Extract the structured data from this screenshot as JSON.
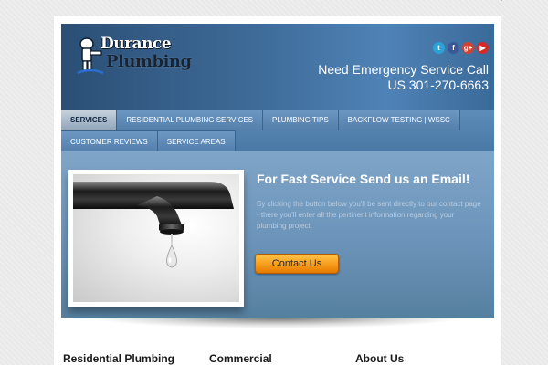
{
  "header": {
    "logo_line1": "Durance",
    "logo_line2": "Plumbing",
    "emergency_line1": "Need Emergency Service Call",
    "emergency_line2": "US 301-270-6663",
    "social": [
      {
        "name": "twitter",
        "glyph": "t"
      },
      {
        "name": "facebook",
        "glyph": "f"
      },
      {
        "name": "google-plus",
        "glyph": "g+"
      },
      {
        "name": "youtube",
        "glyph": "▶"
      }
    ]
  },
  "nav": {
    "row1": [
      "SERVICES",
      "RESIDENTIAL PLUMBING SERVICES",
      "PLUMBING TIPS",
      "BACKFLOW TESTING | WSSC"
    ],
    "row2": [
      "CUSTOMER REVIEWS",
      "SERVICE AREAS"
    ],
    "active": "SERVICES"
  },
  "hero": {
    "title": "For Fast Service Send us an Email!",
    "text": "By clicking the button below you'll be sent directly to our contact page - there you'll enter all the pertinent information regarding your plumbing project.",
    "button_label": "Contact Us"
  },
  "columns": {
    "col1_title": "Residential Plumbing",
    "col2_title": "Commercial",
    "col3_title": "About Us"
  },
  "colors": {
    "header_blue": "#3e6b98",
    "button_orange": "#f79a1a",
    "page_bg": "#e9e9e9"
  }
}
